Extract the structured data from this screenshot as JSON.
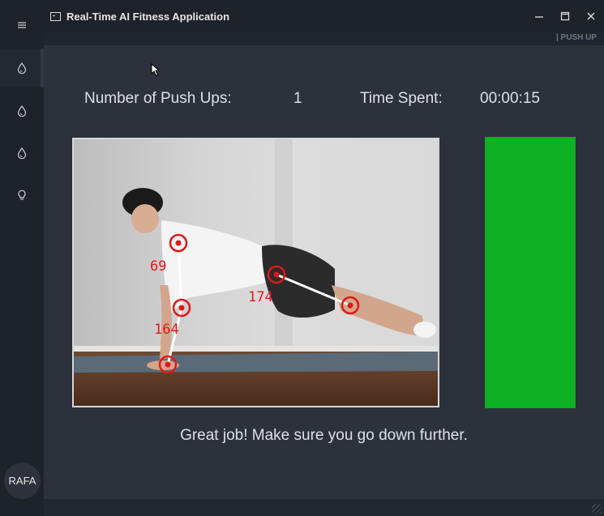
{
  "window": {
    "title": "Real-Time AI Fitness Application",
    "controls": {
      "minimize": "—",
      "maximize": "☐",
      "close": "✕"
    }
  },
  "sidebar": {
    "menu_icon": "hamburger-icon",
    "items": [
      {
        "icon": "drop-icon",
        "active": true
      },
      {
        "icon": "drop-icon",
        "active": false
      },
      {
        "icon": "drop-icon",
        "active": false
      },
      {
        "icon": "lightbulb-icon",
        "active": false
      }
    ],
    "user": "RAFA"
  },
  "header": {
    "mode_label": "| PUSH UP"
  },
  "stats": {
    "count_label": "Number of Push Ups:",
    "count_value": "1",
    "time_label": "Time Spent:",
    "time_value": "00:00:15"
  },
  "camera": {
    "angles": [
      {
        "joint": "elbow",
        "value": "164"
      },
      {
        "joint": "shoulder",
        "value": "69"
      },
      {
        "joint": "hip",
        "value": "174"
      }
    ],
    "joint_color": "#e01818",
    "line_color": "#ffffff"
  },
  "progress": {
    "level": 1.0,
    "color": "#0db123"
  },
  "feedback": "Great job! Make sure you go down further."
}
